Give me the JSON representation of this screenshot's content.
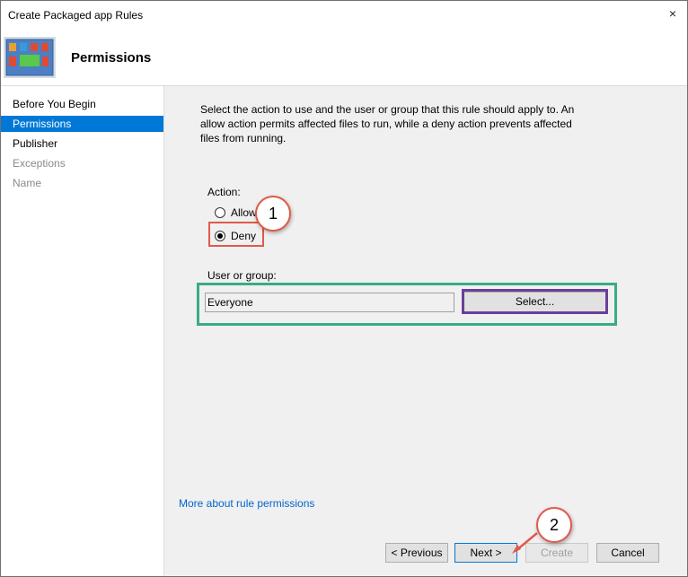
{
  "window": {
    "title": "Create Packaged app Rules",
    "close_icon": "×"
  },
  "header": {
    "title": "Permissions"
  },
  "sidebar": {
    "items": [
      {
        "label": "Before You Begin",
        "state": "normal"
      },
      {
        "label": "Permissions",
        "state": "active"
      },
      {
        "label": "Publisher",
        "state": "normal"
      },
      {
        "label": "Exceptions",
        "state": "disabled"
      },
      {
        "label": "Name",
        "state": "disabled"
      }
    ]
  },
  "main": {
    "description": "Select the action to use and the user or group that this rule should apply to. An allow action permits affected files to run, while a deny action prevents affected files from running.",
    "action_label": "Action:",
    "allow_label": "Allow",
    "deny_label": "Deny",
    "selected_action": "Deny",
    "user_group_label": "User or group:",
    "user_group_value": "Everyone",
    "select_button": "Select...",
    "more_link": "More about rule permissions"
  },
  "footer": {
    "previous_button": "< Previous",
    "next_button": "Next >",
    "create_button": "Create",
    "cancel_button": "Cancel"
  },
  "annotations": {
    "callout_1": "1",
    "callout_2": "2",
    "red": "#e05a4a",
    "green": "#3aaa8a",
    "purple": "#6a3f9a"
  }
}
